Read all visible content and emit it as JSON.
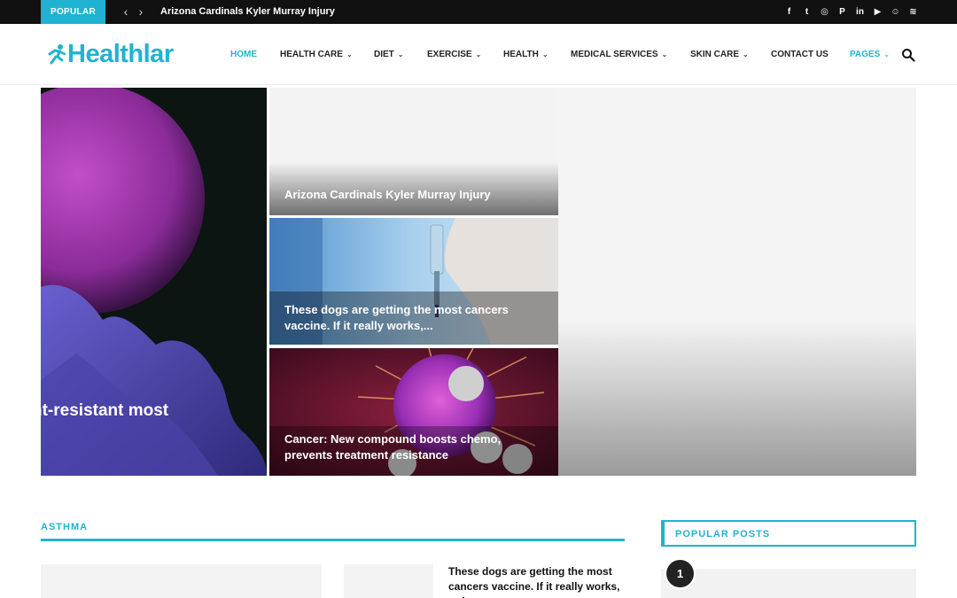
{
  "topbar": {
    "popular_label": "POPULAR",
    "prev_icon": "chevron-left-icon",
    "next_icon": "chevron-right-icon",
    "ticker_text": "Arizona Cardinals Kyler Murray Injury",
    "social": [
      {
        "name": "facebook-icon",
        "glyph": "f"
      },
      {
        "name": "twitter-icon",
        "glyph": "t"
      },
      {
        "name": "instagram-icon",
        "glyph": "◎"
      },
      {
        "name": "pinterest-icon",
        "glyph": "P"
      },
      {
        "name": "linkedin-icon",
        "glyph": "in"
      },
      {
        "name": "youtube-icon",
        "glyph": "▶"
      },
      {
        "name": "snapchat-icon",
        "glyph": "☺"
      },
      {
        "name": "rss-icon",
        "glyph": "≋"
      }
    ]
  },
  "header": {
    "logo_text": "Healthlar",
    "nav": [
      {
        "label": "HOME",
        "dropdown": false,
        "active": true
      },
      {
        "label": "HEALTH CARE",
        "dropdown": true,
        "active": false
      },
      {
        "label": "DIET",
        "dropdown": true,
        "active": false
      },
      {
        "label": "EXERCISE",
        "dropdown": true,
        "active": false
      },
      {
        "label": "HEALTH",
        "dropdown": true,
        "active": false
      },
      {
        "label": "MEDICAL SERVICES",
        "dropdown": true,
        "active": false
      },
      {
        "label": "SKIN CARE",
        "dropdown": true,
        "active": false
      },
      {
        "label": "CONTACT US",
        "dropdown": false,
        "active": false
      },
      {
        "label": "PAGES",
        "dropdown": true,
        "active": true
      }
    ],
    "chevron": "⌄"
  },
  "featured": {
    "main_caption": "nt-resistant most",
    "tiles": [
      {
        "title": "Arizona Cardinals Kyler Murray Injury"
      },
      {
        "title": "These dogs are getting the most cancers vaccine. If it really works,..."
      },
      {
        "title": "Cancer: New compound boosts chemo, prevents treatment resistance"
      }
    ]
  },
  "asthma": {
    "title": "ASTHMA",
    "post2_title": "These dogs are getting the most cancers vaccine. If it really works, rather ..."
  },
  "popular_posts": {
    "title": "POPULAR POSTS",
    "first_rank": "1"
  },
  "colors": {
    "accent": "#1fb3d1",
    "topbar": "#111111"
  }
}
